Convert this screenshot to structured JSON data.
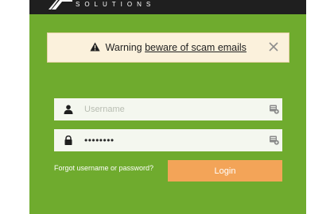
{
  "header": {
    "logo_text": "SOLUTIONS"
  },
  "warning": {
    "prefix": "Warning",
    "link_text": "beware of scam emails",
    "icon": "warning-triangle-icon",
    "close_icon": "close-icon"
  },
  "form": {
    "username": {
      "placeholder": "Username",
      "value": "",
      "icon": "user-icon",
      "manager_icon": "password-manager-icon"
    },
    "password": {
      "value": "••••••••",
      "icon": "lock-icon",
      "manager_icon": "password-manager-icon"
    },
    "forgot_text": "Forgot username or password?",
    "login_label": "Login"
  },
  "colors": {
    "card_bg": "#6fab2e",
    "header_bg": "#1f1f1f",
    "warning_bg": "#fbf1dc",
    "login_bg": "#f3a458",
    "field_bg": "#f4f7ef"
  }
}
